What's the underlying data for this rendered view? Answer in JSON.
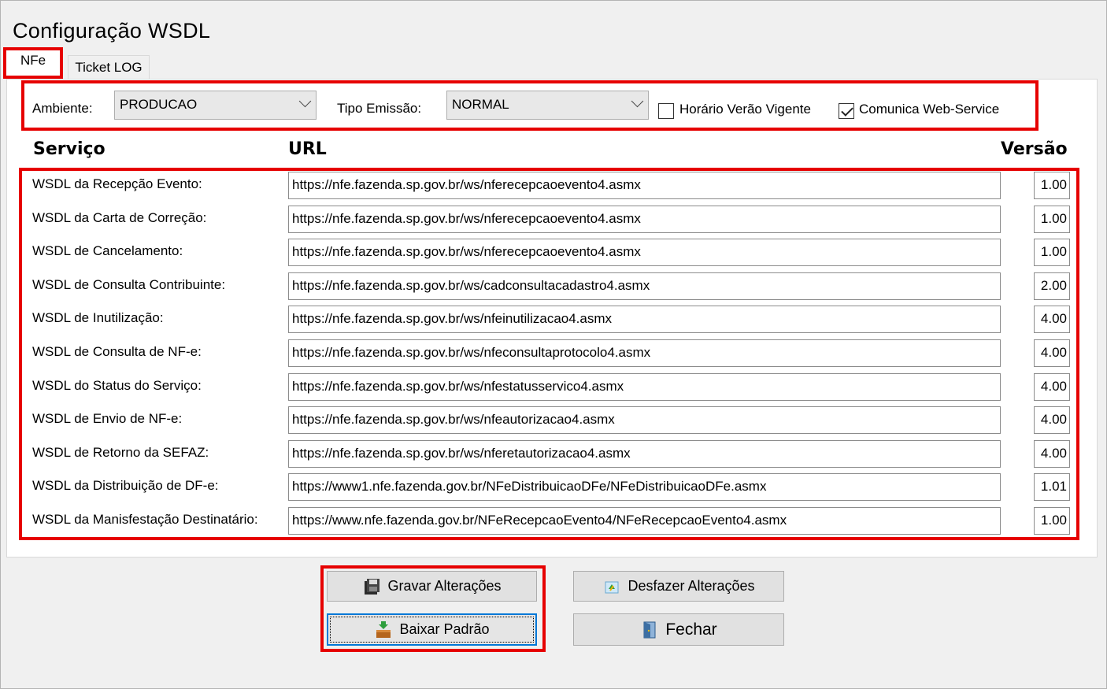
{
  "window": {
    "title": "Configuração WSDL",
    "tabs": [
      {
        "label": "NFe",
        "active": true
      },
      {
        "label": "Ticket LOG",
        "active": false
      }
    ]
  },
  "toolbar": {
    "ambiente_label": "Ambiente:",
    "ambiente_value": "PRODUCAO",
    "tipo_emissao_label": "Tipo Emissão:",
    "tipo_emissao_value": "NORMAL",
    "horario_verao_label": "Horário Verão Vigente",
    "horario_verao_checked": false,
    "comunica_label": "Comunica Web-Service",
    "comunica_checked": true
  },
  "table": {
    "headers": {
      "servico": "Serviço",
      "url": "URL",
      "versao": "Versão"
    },
    "rows": [
      {
        "servico": "WSDL da Recepção Evento:",
        "url": "https://nfe.fazenda.sp.gov.br/ws/nferecepcaoevento4.asmx",
        "versao": "1.00"
      },
      {
        "servico": "WSDL da Carta de Correção:",
        "url": "https://nfe.fazenda.sp.gov.br/ws/nferecepcaoevento4.asmx",
        "versao": "1.00"
      },
      {
        "servico": "WSDL de Cancelamento:",
        "url": "https://nfe.fazenda.sp.gov.br/ws/nferecepcaoevento4.asmx",
        "versao": "1.00"
      },
      {
        "servico": "WSDL de Consulta Contribuinte:",
        "url": "https://nfe.fazenda.sp.gov.br/ws/cadconsultacadastro4.asmx",
        "versao": "2.00"
      },
      {
        "servico": "WSDL de Inutilização:",
        "url": "https://nfe.fazenda.sp.gov.br/ws/nfeinutilizacao4.asmx",
        "versao": "4.00"
      },
      {
        "servico": "WSDL de Consulta de NF-e:",
        "url": "https://nfe.fazenda.sp.gov.br/ws/nfeconsultaprotocolo4.asmx",
        "versao": "4.00"
      },
      {
        "servico": "WSDL do Status do Serviço:",
        "url": "https://nfe.fazenda.sp.gov.br/ws/nfestatusservico4.asmx",
        "versao": "4.00"
      },
      {
        "servico": "WSDL de Envio de NF-e:",
        "url": "https://nfe.fazenda.sp.gov.br/ws/nfeautorizacao4.asmx",
        "versao": "4.00"
      },
      {
        "servico": "WSDL de Retorno da SEFAZ:",
        "url": "https://nfe.fazenda.sp.gov.br/ws/nferetautorizacao4.asmx",
        "versao": "4.00"
      },
      {
        "servico": "WSDL da Distribuição de DF-e:",
        "url": "https://www1.nfe.fazenda.gov.br/NFeDistribuicaoDFe/NFeDistribuicaoDFe.asmx",
        "versao": "1.01"
      },
      {
        "servico": "WSDL da Manisfestação Destinatário:",
        "url": "https://www.nfe.fazenda.gov.br/NFeRecepcaoEvento4/NFeRecepcaoEvento4.asmx",
        "versao": "1.00"
      }
    ]
  },
  "buttons": {
    "gravar": "Gravar Alterações",
    "desfazer": "Desfazer Alterações",
    "baixar": "Baixar Padrão",
    "fechar": "Fechar"
  },
  "colors": {
    "highlight": "#e60000",
    "focus": "#0078d7"
  }
}
